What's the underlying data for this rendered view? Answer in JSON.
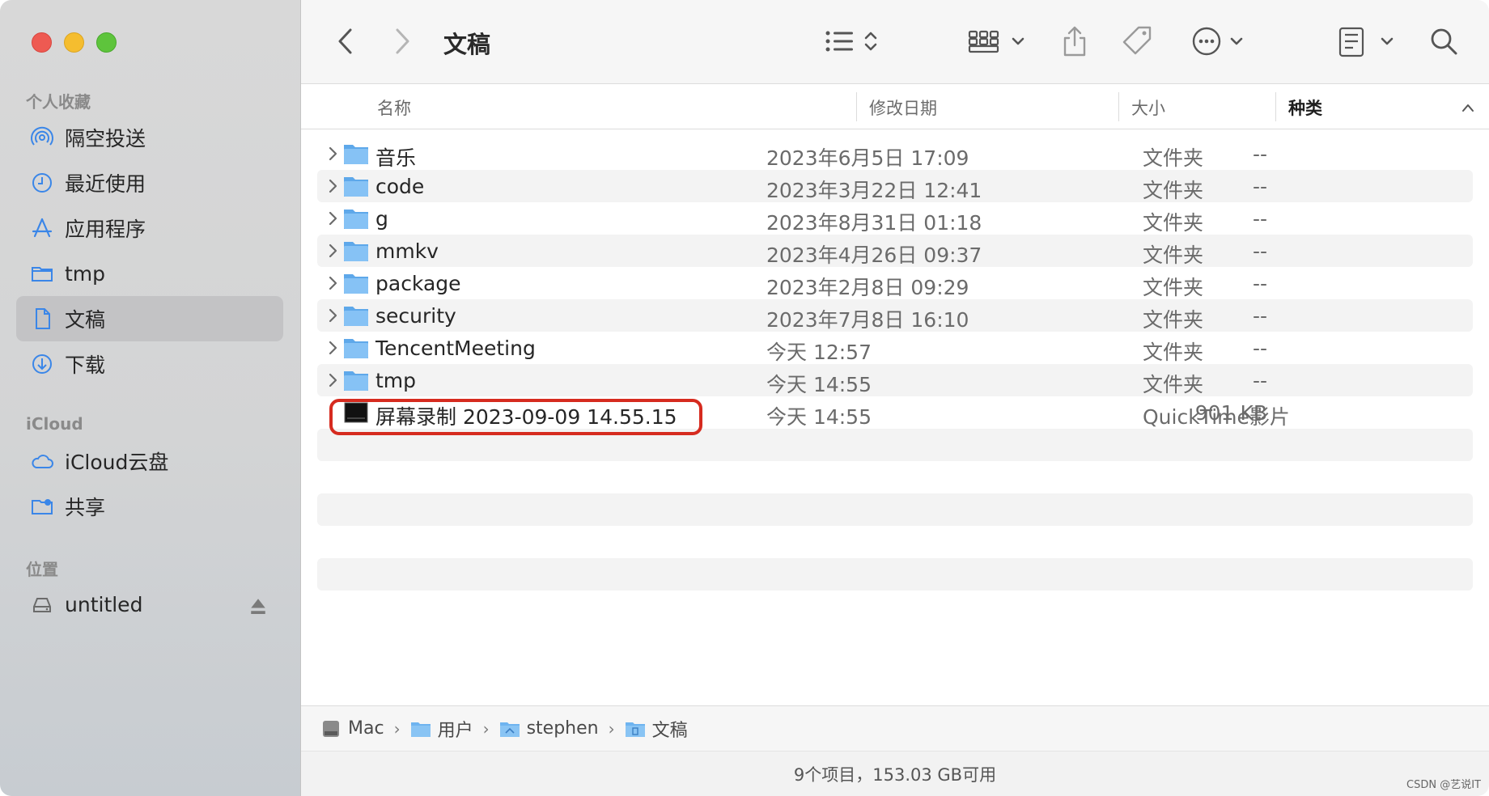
{
  "window": {
    "title": "文稿"
  },
  "sidebar": {
    "sections": [
      {
        "label": "个人收藏"
      },
      {
        "label": "iCloud"
      },
      {
        "label": "位置"
      }
    ],
    "items": [
      {
        "label": "隔空投送",
        "icon": "airdrop-icon"
      },
      {
        "label": "最近使用",
        "icon": "clock-icon"
      },
      {
        "label": "应用程序",
        "icon": "applications-icon"
      },
      {
        "label": "tmp",
        "icon": "folder-icon"
      },
      {
        "label": "文稿",
        "icon": "document-icon",
        "selected": true
      },
      {
        "label": "下载",
        "icon": "download-icon"
      },
      {
        "label": "iCloud云盘",
        "icon": "cloud-icon"
      },
      {
        "label": "共享",
        "icon": "shared-folder-icon"
      },
      {
        "label": "untitled",
        "icon": "drive-icon"
      }
    ]
  },
  "columns": {
    "name": "名称",
    "date": "修改日期",
    "size": "大小",
    "kind": "种类"
  },
  "files": [
    {
      "name": "音乐",
      "date": "2023年6月5日 17:09",
      "size": "--",
      "kind": "文件夹",
      "type": "folder"
    },
    {
      "name": "code",
      "date": "2023年3月22日 12:41",
      "size": "--",
      "kind": "文件夹",
      "type": "folder"
    },
    {
      "name": "g",
      "date": "2023年8月31日 01:18",
      "size": "--",
      "kind": "文件夹",
      "type": "folder"
    },
    {
      "name": "mmkv",
      "date": "2023年4月26日 09:37",
      "size": "--",
      "kind": "文件夹",
      "type": "folder"
    },
    {
      "name": "package",
      "date": "2023年2月8日 09:29",
      "size": "--",
      "kind": "文件夹",
      "type": "folder"
    },
    {
      "name": "security",
      "date": "2023年7月8日 16:10",
      "size": "--",
      "kind": "文件夹",
      "type": "folder"
    },
    {
      "name": "TencentMeeting",
      "date": "今天 12:57",
      "size": "--",
      "kind": "文件夹",
      "type": "folder"
    },
    {
      "name": "tmp",
      "date": "今天 14:55",
      "size": "--",
      "kind": "文件夹",
      "type": "folder"
    },
    {
      "name": "屏幕录制 2023-09-09 14.55.15",
      "date": "今天 14:55",
      "size": "901 KB",
      "kind": "QuickTime影片",
      "type": "movie",
      "highlighted": true
    }
  ],
  "path": [
    "Mac",
    "用户",
    "stephen",
    "文稿"
  ],
  "status": "9个项目，153.03 GB可用",
  "watermark": "CSDN @艺说IT",
  "colors": {
    "highlight": "#d62b1f",
    "folder": "#6fb4f0",
    "selected_sidebar": "#c3c3c5"
  }
}
